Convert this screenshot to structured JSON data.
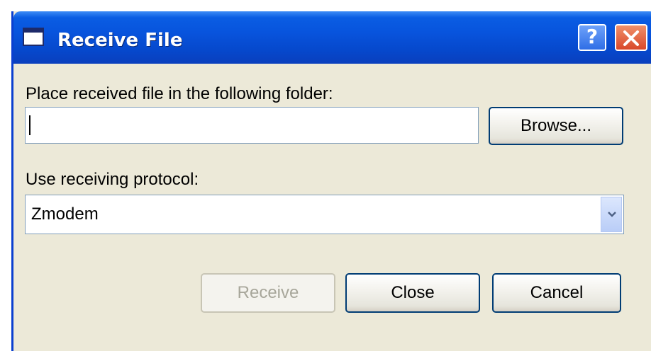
{
  "window": {
    "title": "Receive File",
    "help_label": "?",
    "title_icon": "window-icon",
    "accent_color": "#0854dd"
  },
  "folder": {
    "label": "Place received file in the following folder:",
    "value": "",
    "browse_label": "Browse..."
  },
  "protocol": {
    "label": "Use receiving protocol:",
    "selected": "Zmodem"
  },
  "buttons": {
    "receive": "Receive",
    "close": "Close",
    "cancel": "Cancel"
  }
}
